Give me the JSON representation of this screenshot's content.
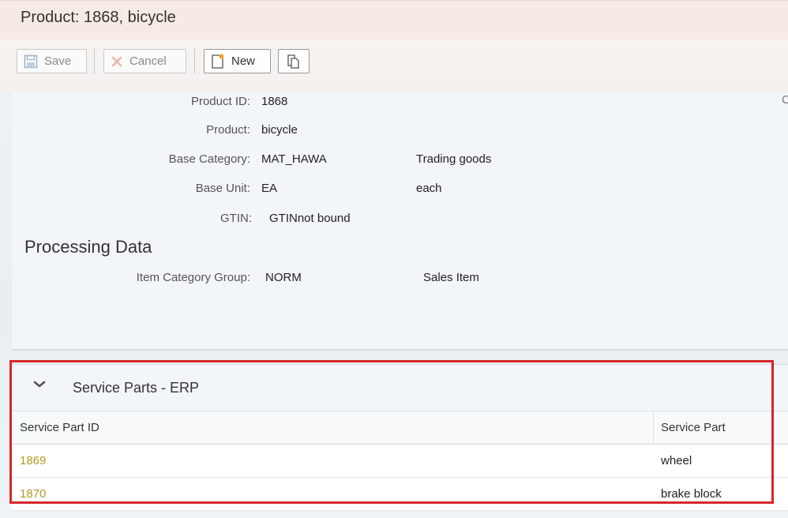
{
  "window": {
    "title": "Product: 1868, bicycle"
  },
  "toolbar": {
    "save_label": "Save",
    "cancel_label": "Cancel",
    "new_label": "New",
    "copy_icon": "copy-icon"
  },
  "form": {
    "product_id_label": "Product ID:",
    "product_id_value": "1868",
    "product_label": "Product:",
    "product_value": "bicycle",
    "base_category_label": "Base Category:",
    "base_category_value": "MAT_HAWA",
    "base_category_desc": "Trading goods",
    "base_unit_label": "Base Unit:",
    "base_unit_value": "EA",
    "base_unit_desc": "each",
    "gtin_label": "GTIN:",
    "gtin_value": "GTINnot bound",
    "edge_char": "C"
  },
  "processing": {
    "section_title": "Processing Data",
    "item_category_group_label": "Item Category Group:",
    "item_category_group_value": "NORM",
    "item_category_group_desc": "Sales Item"
  },
  "service_parts": {
    "title": "Service Parts - ERP",
    "columns": [
      "Service Part ID",
      "Service Part"
    ],
    "rows": [
      {
        "id": "1869",
        "name": "wheel"
      },
      {
        "id": "1870",
        "name": "brake block"
      }
    ]
  },
  "colors": {
    "link": "#b39a22",
    "highlight": "#d6262b"
  }
}
